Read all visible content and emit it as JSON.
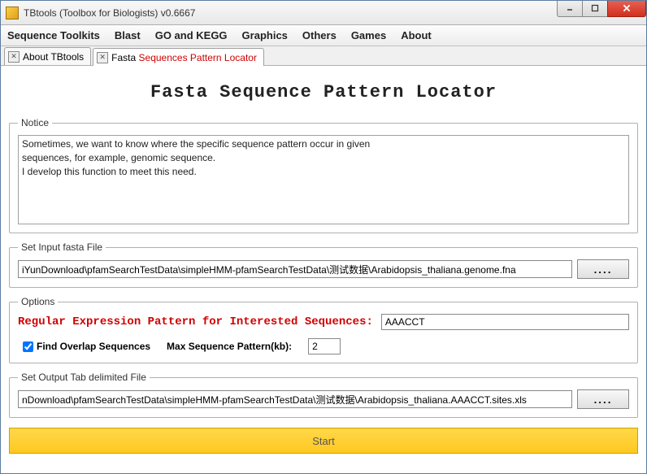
{
  "window": {
    "title": "TBtools (Toolbox for Biologists) v0.6667"
  },
  "menubar": [
    "Sequence Toolkits",
    "Blast",
    "GO and KEGG",
    "Graphics",
    "Others",
    "Games",
    "About"
  ],
  "tabs": [
    {
      "label_plain": "About TBtools",
      "label_red": ""
    },
    {
      "label_plain": "Fasta ",
      "label_red": "Sequences Pattern Locator"
    }
  ],
  "page": {
    "title": "Fasta Sequence Pattern Locator"
  },
  "notice": {
    "legend": "Notice",
    "text": "Sometimes, we want to know where the specific sequence pattern occur in given\nsequences, for example, genomic sequence.\nI develop this function to meet this need."
  },
  "input_file": {
    "legend": "Set Input fasta File",
    "value": "iYunDownload\\pfamSearchTestData\\simpleHMM-pfamSearchTestData\\测试数据\\Arabidopsis_thaliana.genome.fna",
    "browse": "...."
  },
  "options": {
    "legend": "Options",
    "pattern_label": "Regular Expression Pattern for Interested Sequences:",
    "pattern_value": "AAACCT",
    "overlap_label": "Find Overlap Sequences",
    "overlap_checked": true,
    "max_label": "Max Sequence Pattern(kb):",
    "max_value": "2"
  },
  "output_file": {
    "legend": "Set Output Tab delimited File",
    "value": "nDownload\\pfamSearchTestData\\simpleHMM-pfamSearchTestData\\测试数据\\Arabidopsis_thaliana.AAACCT.sites.xls",
    "browse": "...."
  },
  "start": {
    "label": "Start"
  }
}
